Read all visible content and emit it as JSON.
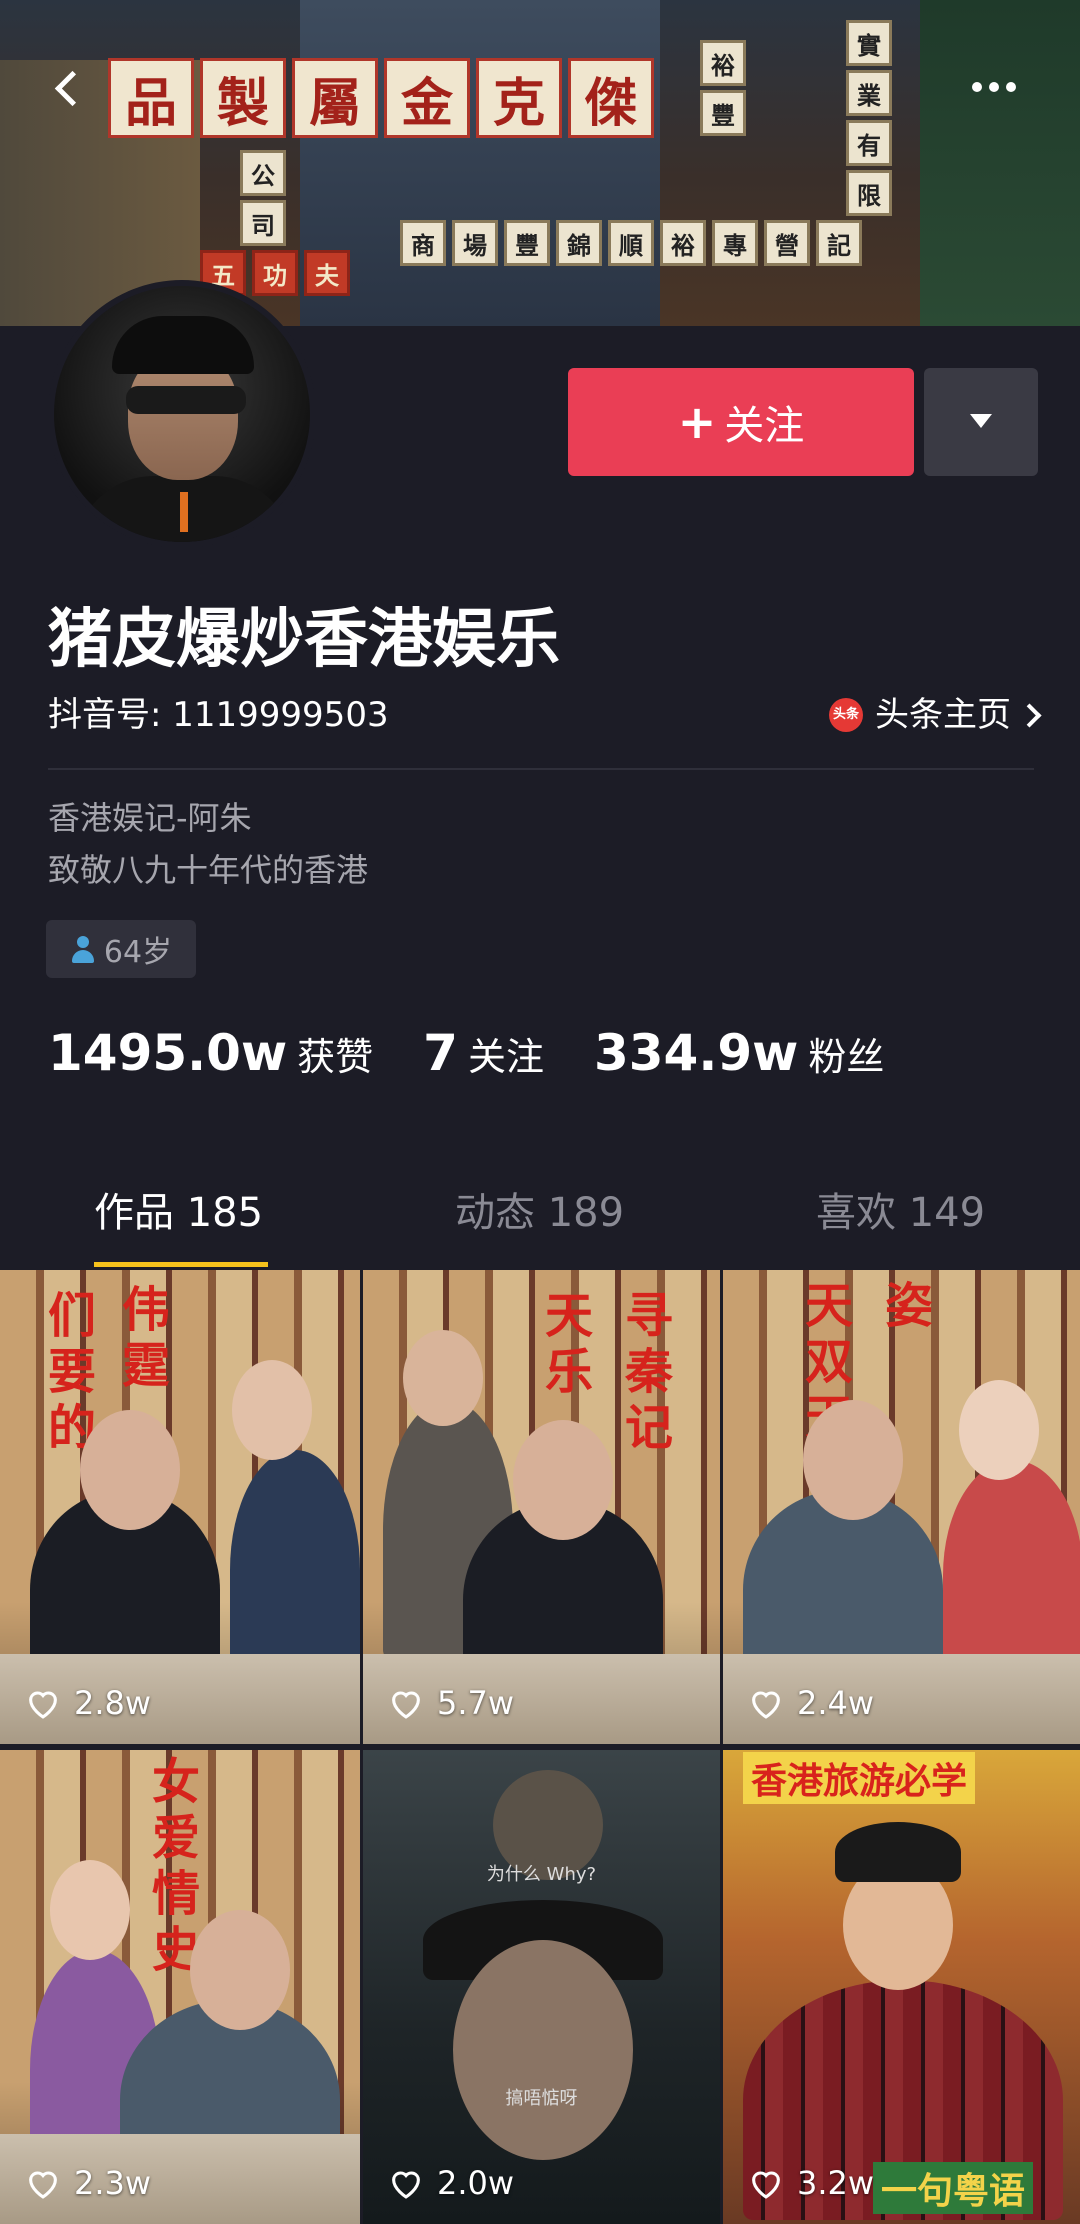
{
  "cover": {
    "big_signs": [
      "品",
      "製",
      "屬",
      "金",
      "克",
      "傑"
    ],
    "small_signs_row1": [
      "公",
      "司",
      "五",
      "功",
      "夫"
    ],
    "small_signs_row2": [
      "商",
      "場",
      "豐",
      "錦",
      "順",
      "裕",
      "專",
      "營",
      "記"
    ],
    "side_signs": [
      "實",
      "業",
      "有",
      "限",
      "公",
      "司",
      "裕",
      "豐"
    ]
  },
  "profile": {
    "name": "猪皮爆炒香港娱乐",
    "account_label": "抖音号: 1119999503",
    "toutiao_logo": "头条",
    "toutiao_label": "头条主页",
    "bio_line1": "香港娱记-阿朱",
    "bio_line2": "致敬八九十年代的香港",
    "age": "64岁"
  },
  "actions": {
    "follow_plus": "+",
    "follow_label": "关注"
  },
  "stats": [
    {
      "num": "1495.0w",
      "label": "获赞"
    },
    {
      "num": "7",
      "label": "关注"
    },
    {
      "num": "334.9w",
      "label": "粉丝"
    }
  ],
  "tabs": [
    {
      "label": "作品 185"
    },
    {
      "label": "动态 189"
    },
    {
      "label": "喜欢 149"
    }
  ],
  "videos": [
    {
      "likes": "2.8w",
      "chars": [
        "们",
        "要",
        "的",
        "伟",
        "霆"
      ]
    },
    {
      "likes": "5.7w",
      "chars": [
        "天",
        "乐",
        "寻",
        "秦",
        "记"
      ]
    },
    {
      "likes": "2.4w",
      "chars": [
        "天",
        "双",
        "天",
        "姿"
      ]
    },
    {
      "likes": "2.3w",
      "chars": [
        "女",
        "爱",
        "情",
        "史"
      ]
    },
    {
      "likes": "2.0w",
      "sub_top": "为什么 Why?",
      "sub_bottom": "搞唔惦呀"
    },
    {
      "likes": "3.2w",
      "banner": "香港旅游必学",
      "banner_bottom": "一句粤语"
    }
  ],
  "colors": {
    "background": "#1c1c26",
    "follow": "#ea3e55",
    "tab_indicator": "#f6c21c",
    "muted_text": "#a6a6ae"
  }
}
